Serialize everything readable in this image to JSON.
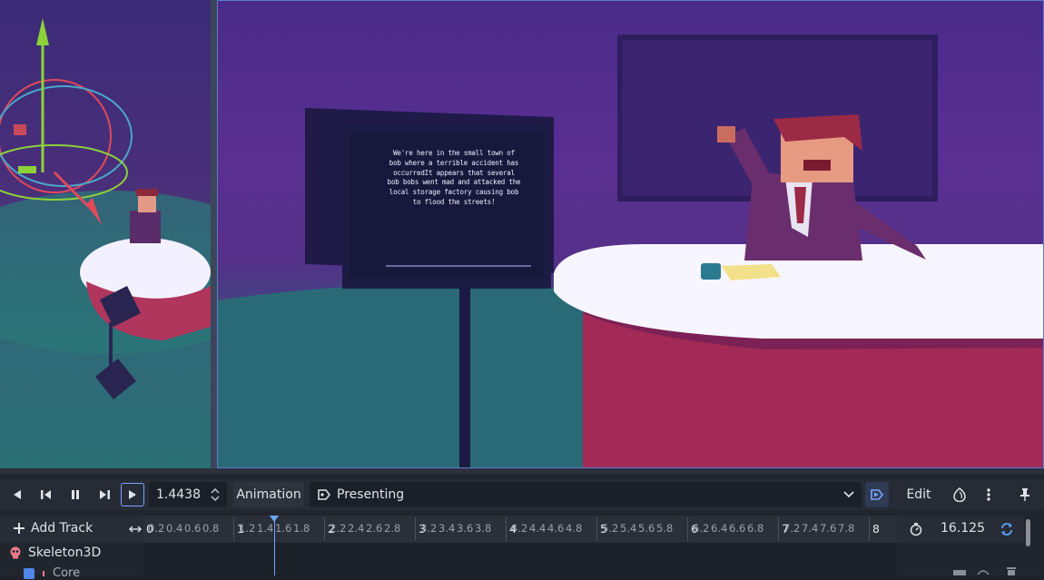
{
  "prompter": {
    "text": "We're here in the small town of bob where a terrible accident has occurredIt appears that several bob bobs went mad and attacked the local storage factory causing bob to flood the streets!"
  },
  "toolbar": {
    "time_value": "1.4438",
    "animation_label": "Animation",
    "animation_name": "Presenting",
    "edit_label": "Edit"
  },
  "timeline": {
    "add_track_label": "Add Track",
    "length_value": "16.125",
    "ruler_ticks": [
      "0",
      "0.2",
      "0.4",
      "0.6",
      "0.8",
      "1",
      "1.2",
      "1.4",
      "1.6",
      "1.8",
      "2",
      "2.2",
      "2.4",
      "2.6",
      "2.8",
      "3",
      "3.2",
      "3.4",
      "3.6",
      "3.8",
      "4",
      "4.2",
      "4.4",
      "4.6",
      "4.8",
      "5",
      "5.2",
      "5.4",
      "5.6",
      "5.8",
      "6",
      "6.2",
      "6.4",
      "6.6",
      "6.8",
      "7",
      "7.2",
      "7.4",
      "7.6",
      "7.8",
      "8"
    ],
    "tracks": [
      {
        "label": "Skeleton3D",
        "icon": "skeleton-icon"
      },
      {
        "label": "Core",
        "icon": "bone-icon"
      }
    ]
  },
  "icons": {
    "play_back": "play-backwards-icon",
    "step_back": "step-back-icon",
    "pause": "pause-icon",
    "step_forward": "step-forward-icon",
    "play": "play-icon",
    "spin": "spinbox-arrows-icon",
    "animation": "animation-icon",
    "dropdown": "chevron-down-icon",
    "autoplay": "autoplay-icon",
    "onion": "onion-skin-icon",
    "more": "more-icon",
    "pin": "pin-icon",
    "length": "timer-icon",
    "loop": "loop-icon"
  },
  "colors": {
    "accent": "#5b7bd5",
    "playhead": "#6aa7ff",
    "panel_bg": "#21252e"
  }
}
